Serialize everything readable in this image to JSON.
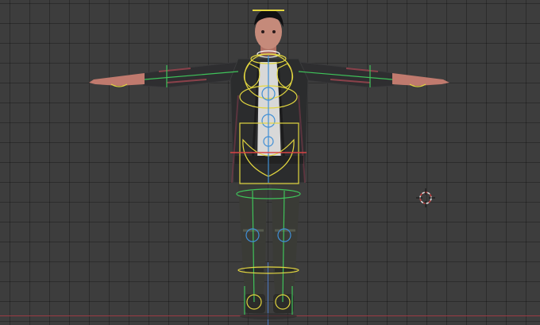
{
  "viewport": {
    "background_color": "#3d3d3d",
    "grid_color": "#2f2f2f",
    "x_axis_color": "#9b3b43",
    "z_axis_color": "#4d7fd0"
  },
  "character": {
    "skin_color": "#c07a6e",
    "jacket_color": "#2b2c2d",
    "shirt_color": "#d8d8d8",
    "hair_color": "#101012"
  },
  "armature": {
    "bone_color": "#e2d63f",
    "selected_bone_color": "#3fc35a",
    "control_color": "#3f8fd6",
    "accent_color": "#d84545"
  },
  "cursor": {
    "icon": "3d-cursor-icon",
    "ring_color_a": "#e0e0e0",
    "ring_color_b": "#c04040"
  }
}
